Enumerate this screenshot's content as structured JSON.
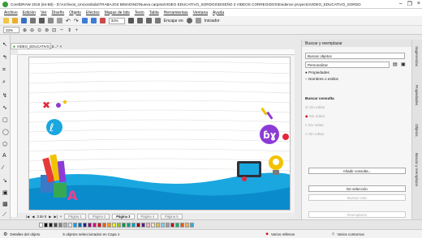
{
  "window": {
    "title": "CorelDRAW 2019 (64-Bit) - D:\\Archivos_Uniconsbdia\\TRABAJOS BIMADINO\\Nueva carpeta\\VIDEO EDUCATIVO_SORDOS\\DISEÑO 3 VIDEOS CORREGIDOS\\Evidence proyecto\\VIDEO_EDUCATIVO_SORDOS_EMOCIONES_SENTIMIENT...*"
  },
  "menu": [
    "Archivo",
    "Edición",
    "Ver",
    "Diseño",
    "Objeto",
    "Efectos",
    "Mapas de bits",
    "Texto",
    "Tabla",
    "Herramientas",
    "Ventana",
    "Ayuda"
  ],
  "toolbar": {
    "zoom_value": "33%",
    "snap_label": "Encajar en",
    "launcher_label": "Iniciador",
    "zoom_field": "33%"
  },
  "document_tab": "VIDEO_EDUCATIVO_S...*",
  "pages": {
    "tabs": [
      "Página 1",
      "Página 2",
      "Página 3",
      "Página 4",
      "Página 5"
    ],
    "active_index": 2
  },
  "docker": {
    "title": "Buscar y reemplazar",
    "search_field": "Buscar objetos",
    "preset_field": "Personalizar",
    "radio_properties": "Propiedades",
    "radio_names": "Nombres o estilos",
    "query_title": "Buscar consulta",
    "items": [
      "Sin editar",
      "Sin editar",
      "Sin editar",
      "Sin editar"
    ],
    "add_query_button": "Añadir consulta...",
    "selection_button": "De selección",
    "find_all_button": "Buscar todo",
    "replace_button": "Reemplazar"
  },
  "side_tabs": [
    "Sugerencias",
    "Propiedades",
    "Objetos",
    "Buscar y reemplazar"
  ],
  "status": {
    "details": "Detalles del objeto",
    "selection": "5 objetos seleccionados en Capa 1",
    "fill": "Varios rellenos",
    "outline": "Varios contornos"
  },
  "colors": {
    "accent_blue": "#1aa7e0",
    "page_bg": "#ffffff"
  },
  "palette": [
    "#ffffff",
    "#000000",
    "#1a1a1a",
    "#4d4d4d",
    "#808080",
    "#b3b3b3",
    "#e6e6e6",
    "#00a0e9",
    "#0068b7",
    "#1d2088",
    "#920783",
    "#e4007f",
    "#e60012",
    "#eb6100",
    "#f39800",
    "#fff100",
    "#8fc31f",
    "#009944",
    "#009e96",
    "#00a0c1",
    "#a40000",
    "#601986",
    "#f5b2b2",
    "#fce2c4",
    "#d7c447",
    "#7ecef4",
    "#9e9e9f",
    "#c30d23",
    "#13ae67",
    "#ea5514",
    "#f8b551",
    "#2ea7e0"
  ]
}
